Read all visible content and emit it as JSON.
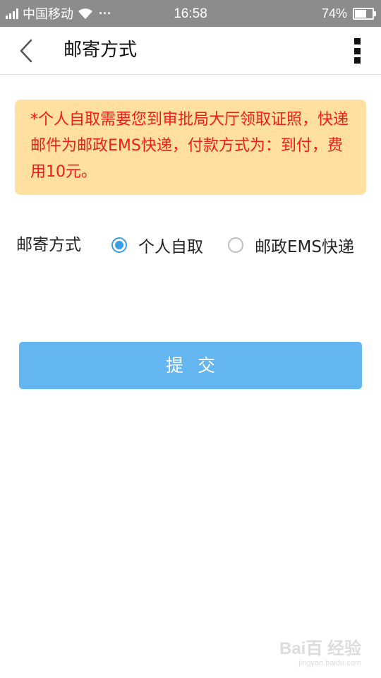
{
  "status_bar": {
    "carrier": "中国移动",
    "dots": "···",
    "time": "16:58",
    "battery_text": "74%",
    "battery_level": 0.74
  },
  "header": {
    "title": "邮寄方式"
  },
  "notice": {
    "text": "*个人自取需要您到审批局大厅领取证照，快递邮件为邮政EMS快递，付款方式为：到付，费用10元。"
  },
  "delivery": {
    "label": "邮寄方式",
    "options": [
      {
        "label": "个人自取",
        "selected": true
      },
      {
        "label": "邮政EMS快递",
        "selected": false
      }
    ]
  },
  "submit": {
    "label": "提交"
  },
  "watermark": {
    "logo": "Bai百 经验",
    "sub": "jingyan.baidu.com"
  },
  "colors": {
    "accent": "#3a9ee4",
    "button": "#63b6ef",
    "notice_bg": "#ffe0a0",
    "notice_text": "#ee1c1c",
    "status_bar": "#8c8c8c"
  }
}
